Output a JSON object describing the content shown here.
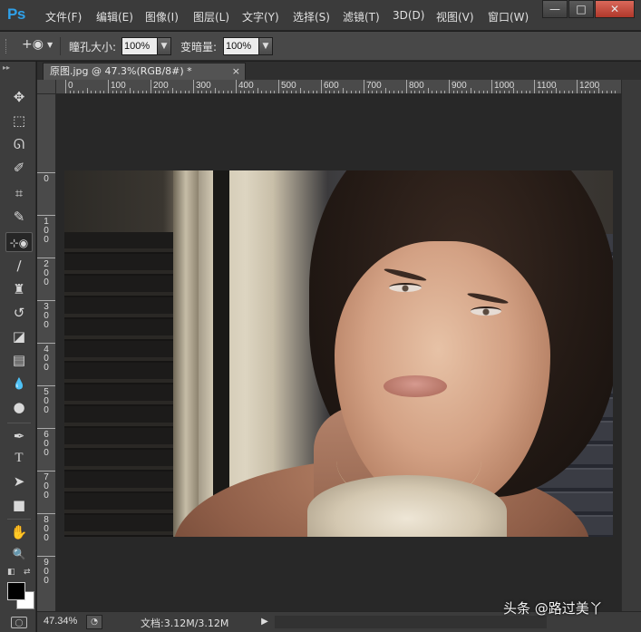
{
  "app": {
    "logo": "Ps",
    "menu": [
      "文件(F)",
      "编辑(E)",
      "图像(I)",
      "图层(L)",
      "文字(Y)",
      "选择(S)",
      "滤镜(T)",
      "3D(D)",
      "视图(V)",
      "窗口(W)"
    ],
    "window_controls": [
      "—",
      "□",
      "✕"
    ]
  },
  "options_bar": {
    "pupil_size_label": "瞳孔大小:",
    "pupil_size_value": "100%",
    "darken_label": "变暗量:",
    "darken_value": "100%"
  },
  "tools": [
    {
      "name": "move-tool",
      "glyph": "✥"
    },
    {
      "name": "marquee-tool",
      "glyph": "⬚"
    },
    {
      "name": "lasso-tool",
      "glyph": "ᘏ"
    },
    {
      "name": "quick-selection-tool",
      "glyph": "✐"
    },
    {
      "name": "crop-tool",
      "glyph": "⌗"
    },
    {
      "name": "eyedropper-tool",
      "glyph": "✎"
    },
    {
      "name": "red-eye-tool",
      "glyph": "⊹◉"
    },
    {
      "name": "brush-tool",
      "glyph": "∕"
    },
    {
      "name": "clone-stamp-tool",
      "glyph": "♜"
    },
    {
      "name": "history-brush-tool",
      "glyph": "↺"
    },
    {
      "name": "eraser-tool",
      "glyph": "◪"
    },
    {
      "name": "gradient-tool",
      "glyph": "▤"
    },
    {
      "name": "blur-tool",
      "glyph": "💧"
    },
    {
      "name": "dodge-tool",
      "glyph": "●"
    },
    {
      "name": "pen-tool",
      "glyph": "✒"
    },
    {
      "name": "type-tool",
      "glyph": "T"
    },
    {
      "name": "path-selection-tool",
      "glyph": "➤"
    },
    {
      "name": "rectangle-tool",
      "glyph": "■"
    },
    {
      "name": "hand-tool",
      "glyph": "✋"
    },
    {
      "name": "zoom-tool",
      "glyph": "🔍"
    }
  ],
  "document": {
    "tab_title": "原图.jpg @ 47.3%(RGB/8#) *",
    "tab_close": "×"
  },
  "ruler": {
    "horizontal": [
      "0",
      "100",
      "200",
      "300",
      "400",
      "500",
      "600",
      "700",
      "800",
      "900",
      "1000",
      "1100",
      "1200"
    ],
    "vertical": [
      "0",
      "100",
      "200",
      "300",
      "400",
      "500",
      "600",
      "700",
      "800",
      "900"
    ]
  },
  "status": {
    "zoom": "47.34%",
    "doc_info": "文档:3.12M/3.12M",
    "arrow": "▶"
  },
  "watermark": "头条 @路过美丫",
  "colors": {
    "accent": "#2fa0e8",
    "foreground_swatch": "#000000",
    "background_swatch": "#ffffff"
  }
}
